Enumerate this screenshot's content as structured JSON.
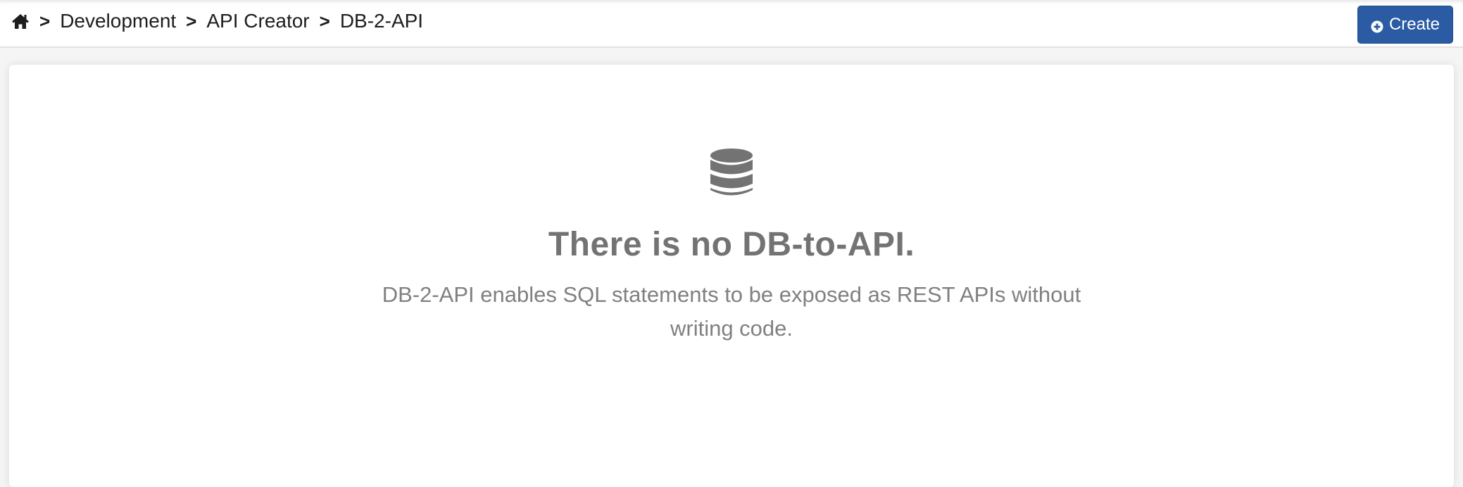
{
  "breadcrumb": {
    "home_icon": "home-icon",
    "separator": ">",
    "items": [
      {
        "label": "Development"
      },
      {
        "label": "API Creator"
      },
      {
        "label": "DB-2-API"
      }
    ]
  },
  "toolbar": {
    "create_label": "Create",
    "create_icon": "plus-circle-icon",
    "create_color": "#2a5ba3"
  },
  "empty_state": {
    "icon": "database-icon",
    "title": "There is no DB-to-API.",
    "description": "DB-2-API enables SQL statements to be exposed as REST APIs without writing code."
  }
}
